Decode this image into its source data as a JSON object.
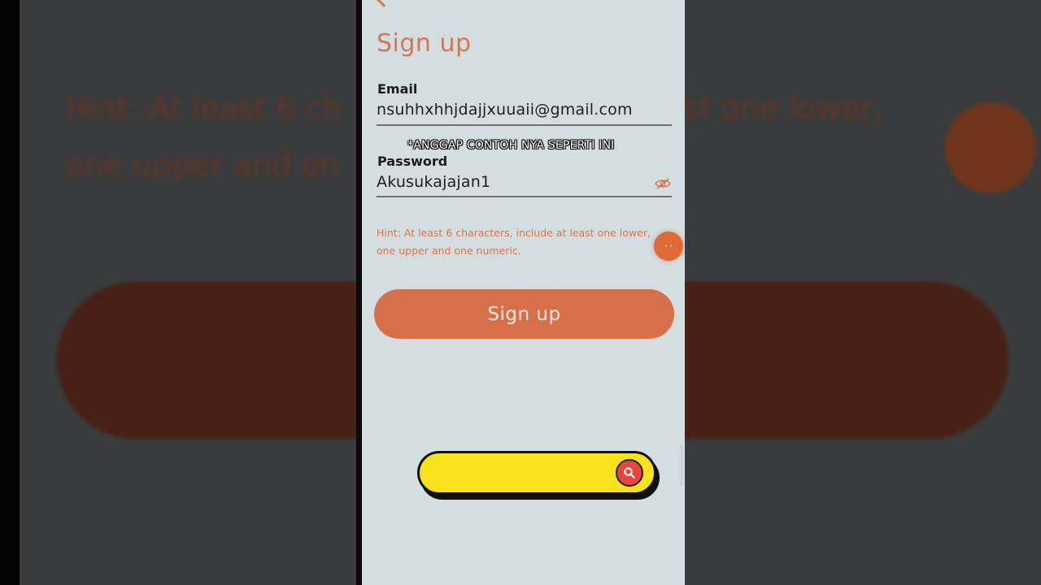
{
  "page": {
    "title": "Sign up"
  },
  "form": {
    "email_label": "Email",
    "email_value": "nsuhhxhhjdajjxuuaii@gmail.com",
    "password_label": "Password",
    "password_value": "Akusukajajan1",
    "hint": "Hint: At least 6 characters, include at least one lower, one upper and one numeric.",
    "submit_label": "Sign up"
  },
  "overlay": {
    "caption": "*ANGGAP CONTOH NYA SEPERTI INI"
  },
  "background": {
    "hint_fragment": "Hint: At least 6 ch",
    "hint_fragment_2": "one upper and on",
    "hint_fragment_3": "least one lower,"
  },
  "icons": {
    "password_toggle": "eye-off-icon",
    "back": "chevron-left-icon",
    "search": "search-icon"
  },
  "colors": {
    "accent": "#d7764e",
    "phone_background": "#d4dee0",
    "search_pill": "#f7e21d",
    "search_button": "#e5463d"
  }
}
